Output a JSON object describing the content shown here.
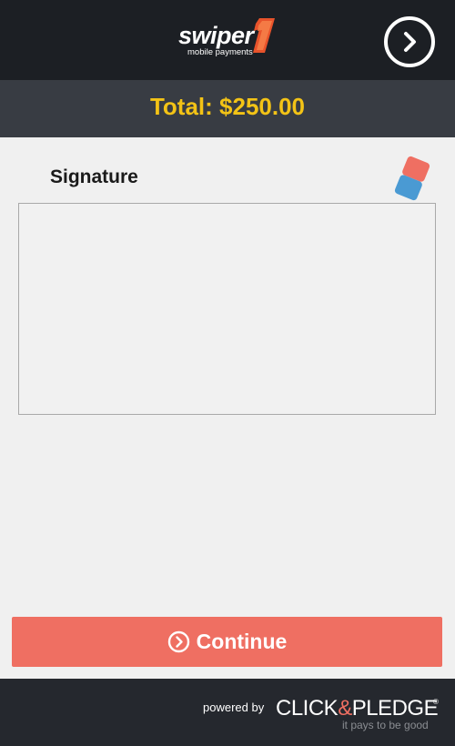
{
  "header": {
    "logo_word": "swiper",
    "logo_subtitle": "mobile payments",
    "next_icon": "chevron-right-circle-icon"
  },
  "total": {
    "label": "Total: $250.00"
  },
  "signature": {
    "label": "Signature",
    "clear_icon": "eraser-icon"
  },
  "actions": {
    "continue_label": "Continue",
    "continue_icon": "chevron-right-circle-icon"
  },
  "footer": {
    "powered_by": "powered by",
    "brand_left": "CLICK",
    "brand_amp": "&",
    "brand_right": "PLEDGE",
    "brand_mark": "®",
    "tagline": "it pays to be good"
  },
  "colors": {
    "header_bg": "#1c1f24",
    "total_bar_bg": "#383c43",
    "total_text": "#f3c316",
    "continue_bg": "#ef6f62",
    "footer_bg": "#25282e",
    "logo_accent": "#e8532b"
  }
}
